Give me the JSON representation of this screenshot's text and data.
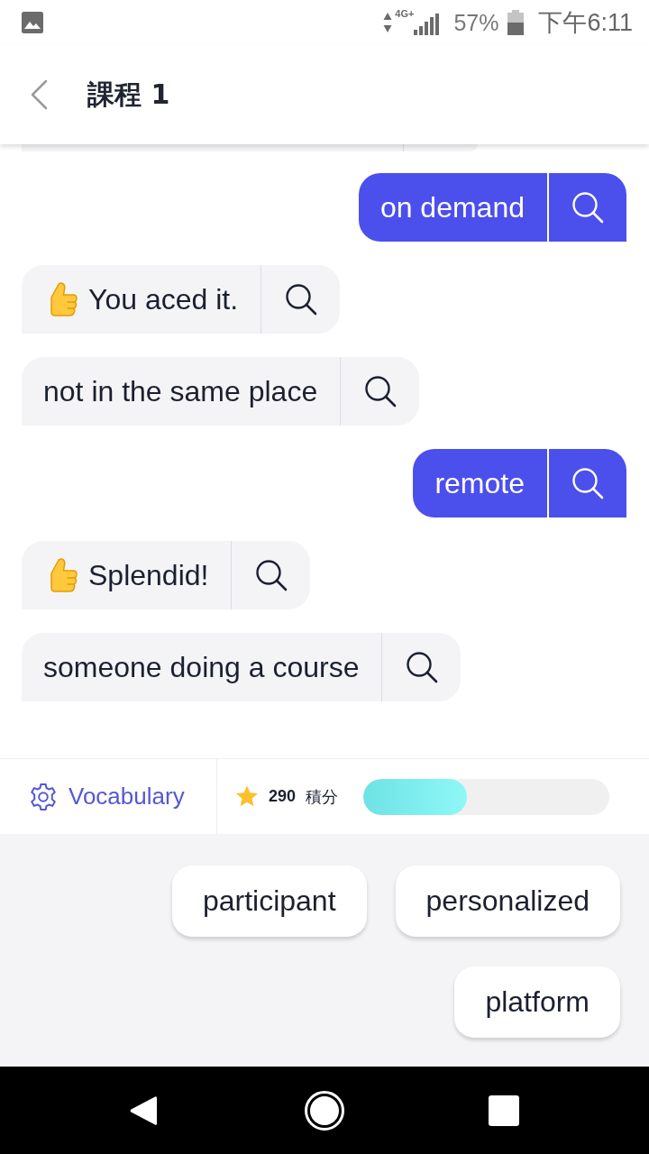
{
  "status_bar": {
    "network": "4G+",
    "battery": "57%",
    "time": "下午6:11"
  },
  "header": {
    "title": "課程 1"
  },
  "messages": [
    {
      "kind": "user",
      "text": "on demand"
    },
    {
      "kind": "praise",
      "text": "You aced it."
    },
    {
      "kind": "bot",
      "text": "not in the same place"
    },
    {
      "kind": "user",
      "text": "remote"
    },
    {
      "kind": "praise",
      "text": "Splendid!"
    },
    {
      "kind": "bot",
      "text": "someone doing a course"
    }
  ],
  "footer": {
    "vocabulary": "Vocabulary",
    "points": "290",
    "points_label": "積分",
    "level": 0.42
  },
  "word_choices": [
    "participant",
    "personalized",
    "platform"
  ]
}
